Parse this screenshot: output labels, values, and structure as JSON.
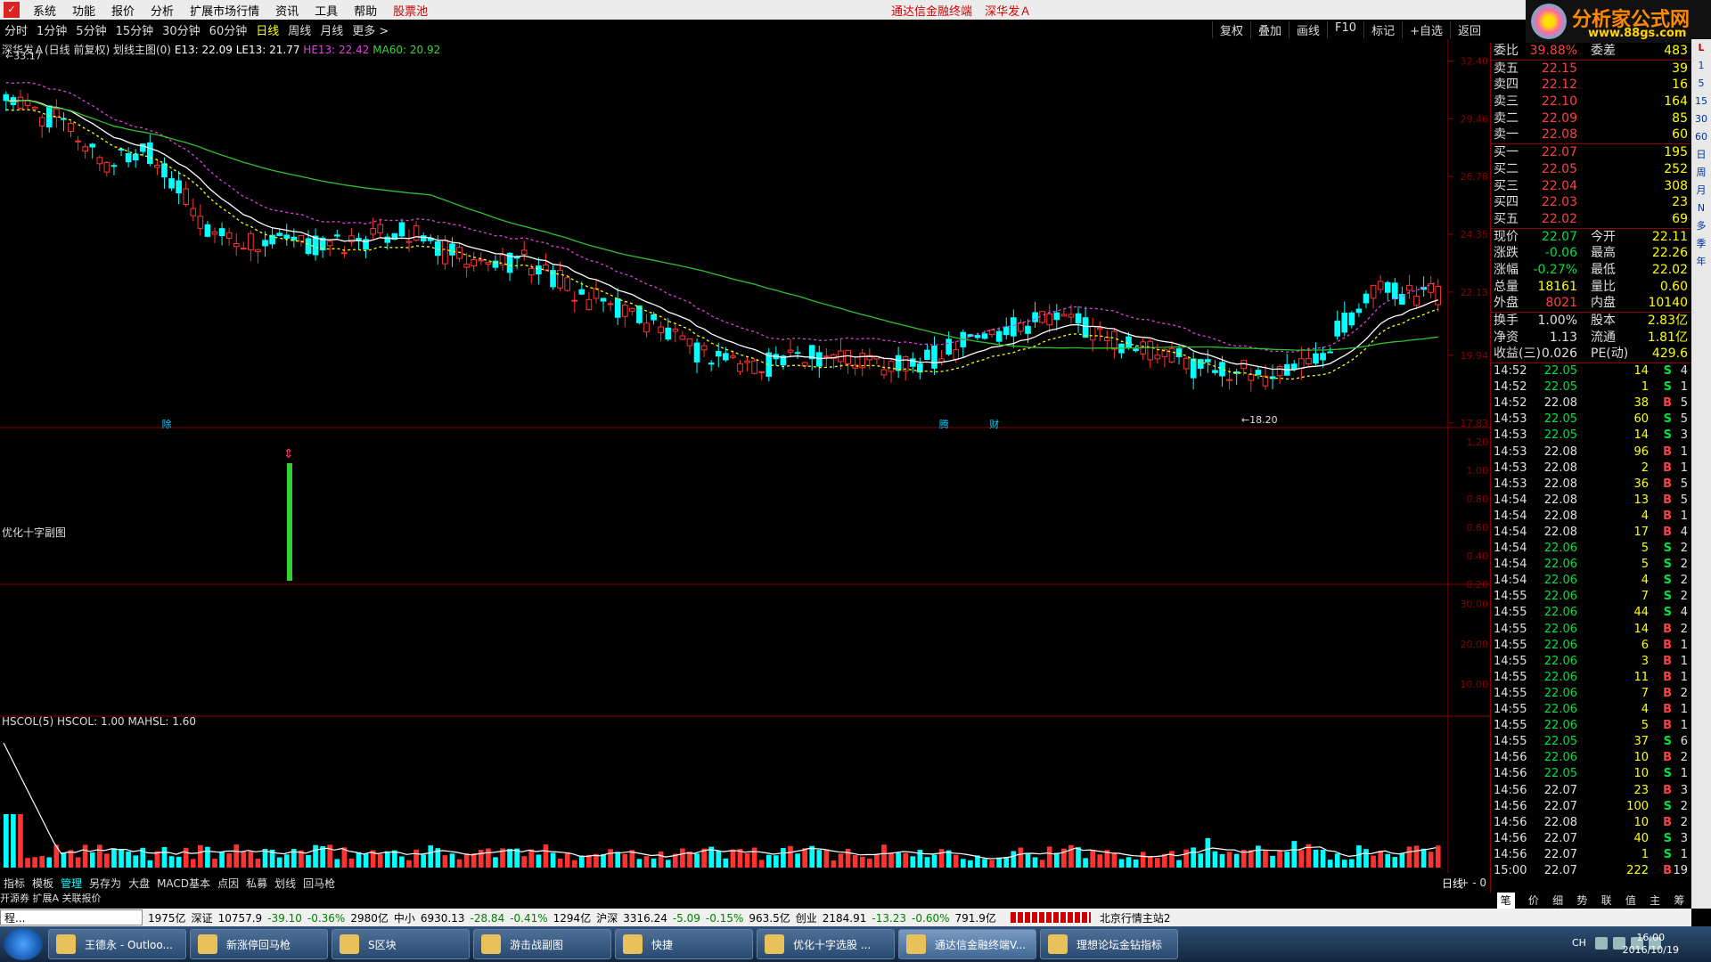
{
  "menu": {
    "items": [
      "系统",
      "功能",
      "报价",
      "分析",
      "扩展市场行情",
      "资讯",
      "工具",
      "帮助"
    ],
    "red_item": "股票池",
    "center_title": [
      "通达信金融终端",
      "深华发Ａ"
    ]
  },
  "periods": {
    "items": [
      "分时",
      "1分钟",
      "5分钟",
      "15分钟",
      "30分钟",
      "60分钟",
      "日线",
      "周线",
      "月线",
      "更多 >"
    ],
    "active": "日线",
    "right_tools": [
      "复权",
      "叠加",
      "画线",
      "F10",
      "标记",
      "+自选",
      "返回"
    ]
  },
  "logo": {
    "title": "分析家公式网",
    "url": "www.88gs.com"
  },
  "main_chart": {
    "legend": {
      "name": "深华发Ａ(日线 前复权) 划线主图(0)",
      "e13": "E13: 22.09",
      "le13": "LE13: 21.77",
      "he13": "HE13: 22.42",
      "ma60": "MA60: 20.92"
    },
    "y_ticks": [
      "32.40",
      "29.46",
      "26.78",
      "24.35",
      "22.13",
      "19.94",
      "17.83"
    ],
    "high_label": "33.17",
    "low_label": "18.20",
    "markers": [
      "除",
      "腾",
      "财"
    ]
  },
  "sub1": {
    "title": "优化十字副图",
    "y_ticks": [
      "1.20",
      "1.00",
      "0.80",
      "0.60",
      "0.40",
      "0.20"
    ]
  },
  "sub2": {
    "title": "HSCOL(5) HSCOL: 1.00 MAHSL: 1.60",
    "y_ticks": [
      "30.00",
      "20.00",
      "10.00"
    ]
  },
  "bottom": {
    "items": [
      "指标",
      "模板",
      "管理",
      "另存为",
      "大盘",
      "MACD基本",
      "点因",
      "私募",
      "划线",
      "回马枪"
    ],
    "active": "管理",
    "right": "日线",
    "controls": "+ - 0",
    "second_row": [
      "开源券",
      "扩展A",
      "关联报价"
    ]
  },
  "quote": {
    "weibi": {
      "label": "委比",
      "value": "39.88%",
      "label2": "委差",
      "value2": "483"
    },
    "asks": [
      {
        "label": "卖五",
        "price": "22.15",
        "vol": "39"
      },
      {
        "label": "卖四",
        "price": "22.12",
        "vol": "16"
      },
      {
        "label": "卖三",
        "price": "22.10",
        "vol": "164"
      },
      {
        "label": "卖二",
        "price": "22.09",
        "vol": "85"
      },
      {
        "label": "卖一",
        "price": "22.08",
        "vol": "60"
      }
    ],
    "bids": [
      {
        "label": "买一",
        "price": "22.07",
        "vol": "195"
      },
      {
        "label": "买二",
        "price": "22.05",
        "vol": "252"
      },
      {
        "label": "买三",
        "price": "22.04",
        "vol": "308"
      },
      {
        "label": "买四",
        "price": "22.03",
        "vol": "23"
      },
      {
        "label": "买五",
        "price": "22.02",
        "vol": "69"
      }
    ],
    "stats": [
      {
        "l1": "现价",
        "v1": "22.07",
        "c1": "green",
        "l2": "今开",
        "v2": "22.11"
      },
      {
        "l1": "涨跌",
        "v1": "-0.06",
        "c1": "green",
        "l2": "最高",
        "v2": "22.26"
      },
      {
        "l1": "涨幅",
        "v1": "-0.27%",
        "c1": "green",
        "l2": "最低",
        "v2": "22.02"
      },
      {
        "l1": "总量",
        "v1": "18161",
        "c1": "yel",
        "l2": "量比",
        "v2": "0.60"
      },
      {
        "l1": "外盘",
        "v1": "8021",
        "c1": "red",
        "l2": "内盘",
        "v2": "10140"
      }
    ],
    "stats2": [
      {
        "l1": "换手",
        "v1": "1.00%",
        "l2": "股本",
        "v2": "2.83亿"
      },
      {
        "l1": "净资",
        "v1": "1.13",
        "l2": "流通",
        "v2": "1.81亿"
      },
      {
        "l1": "收益(三)",
        "v1": "0.026",
        "l2": "PE(动)",
        "v2": "429.6"
      }
    ],
    "ticks": [
      [
        "14:52",
        "22.05",
        "14",
        "S",
        "4"
      ],
      [
        "14:52",
        "22.05",
        "1",
        "S",
        "1"
      ],
      [
        "14:52",
        "22.08",
        "38",
        "B",
        "5"
      ],
      [
        "14:53",
        "22.05",
        "60",
        "S",
        "5"
      ],
      [
        "14:53",
        "22.05",
        "14",
        "S",
        "3"
      ],
      [
        "14:53",
        "22.08",
        "96",
        "B",
        "1"
      ],
      [
        "14:53",
        "22.08",
        "2",
        "B",
        "1"
      ],
      [
        "14:53",
        "22.08",
        "36",
        "B",
        "5"
      ],
      [
        "14:54",
        "22.08",
        "13",
        "B",
        "5"
      ],
      [
        "14:54",
        "22.08",
        "4",
        "B",
        "1"
      ],
      [
        "14:54",
        "22.08",
        "17",
        "B",
        "4"
      ],
      [
        "14:54",
        "22.06",
        "5",
        "S",
        "2"
      ],
      [
        "14:54",
        "22.06",
        "5",
        "S",
        "2"
      ],
      [
        "14:54",
        "22.06",
        "4",
        "S",
        "2"
      ],
      [
        "14:55",
        "22.06",
        "7",
        "S",
        "2"
      ],
      [
        "14:55",
        "22.06",
        "44",
        "S",
        "4"
      ],
      [
        "14:55",
        "22.06",
        "14",
        "B",
        "2"
      ],
      [
        "14:55",
        "22.06",
        "6",
        "B",
        "1"
      ],
      [
        "14:55",
        "22.06",
        "3",
        "B",
        "1"
      ],
      [
        "14:55",
        "22.06",
        "11",
        "B",
        "1"
      ],
      [
        "14:55",
        "22.06",
        "7",
        "B",
        "2"
      ],
      [
        "14:55",
        "22.06",
        "4",
        "B",
        "1"
      ],
      [
        "14:55",
        "22.06",
        "5",
        "B",
        "1"
      ],
      [
        "14:55",
        "22.05",
        "37",
        "S",
        "6"
      ],
      [
        "14:56",
        "22.06",
        "10",
        "B",
        "2"
      ],
      [
        "14:56",
        "22.05",
        "10",
        "S",
        "1"
      ],
      [
        "14:56",
        "22.07",
        "23",
        "B",
        "3"
      ],
      [
        "14:56",
        "22.07",
        "100",
        "S",
        "2"
      ],
      [
        "14:56",
        "22.08",
        "10",
        "B",
        "2"
      ],
      [
        "14:56",
        "22.07",
        "40",
        "S",
        "3"
      ],
      [
        "14:56",
        "22.07",
        "1",
        "S",
        "1"
      ],
      [
        "15:00",
        "22.07",
        "222",
        "B",
        "19"
      ]
    ],
    "tabs": [
      "笔",
      "价",
      "细",
      "势",
      "联",
      "值",
      "主",
      "筹"
    ],
    "active_tab": "笔"
  },
  "vstrip": [
    "L",
    "1",
    "5",
    "15",
    "30",
    "60",
    "日",
    "周",
    "月",
    "N",
    "多",
    "季",
    "年"
  ],
  "statusbar": {
    "mini": "程...",
    "indexes": [
      {
        "pre": "1975亿",
        "name": "深证",
        "v": "10757.9",
        "chg": "-39.10",
        "pct": "-0.36%",
        "amt": "2980亿"
      },
      {
        "name": "中小",
        "v": "6930.13",
        "chg": "-28.84",
        "pct": "-0.41%",
        "amt": "1294亿"
      },
      {
        "name": "沪深",
        "v": "3316.24",
        "chg": "-5.09",
        "pct": "-0.15%",
        "amt": "963.5亿"
      },
      {
        "name": "创业",
        "v": "2184.91",
        "chg": "-13.23",
        "pct": "-0.60%",
        "amt": "791.9亿"
      }
    ],
    "server": "北京行情主站2"
  },
  "taskbar": {
    "tasks": [
      "王德永 - Outloo...",
      "新涨停回马枪",
      "S区块",
      "游击战副图",
      "快捷",
      "优化十字选股 ...",
      "通达信金融终端V...",
      "理想论坛金钻指标"
    ],
    "active": "通达信金融终端V...",
    "tray_lang": "CH",
    "time": "16:00",
    "date": "2016/10/19"
  },
  "chart_data": {
    "type": "candlestick",
    "title": "深华发Ａ(日线 前复权)",
    "y_range": [
      17.8,
      33.2
    ],
    "high": 33.17,
    "low": 18.2,
    "last_close": 22.07,
    "ma60_last": 20.92,
    "e13_last": 22.09,
    "le13_last": 21.77,
    "he13_last": 22.42
  }
}
